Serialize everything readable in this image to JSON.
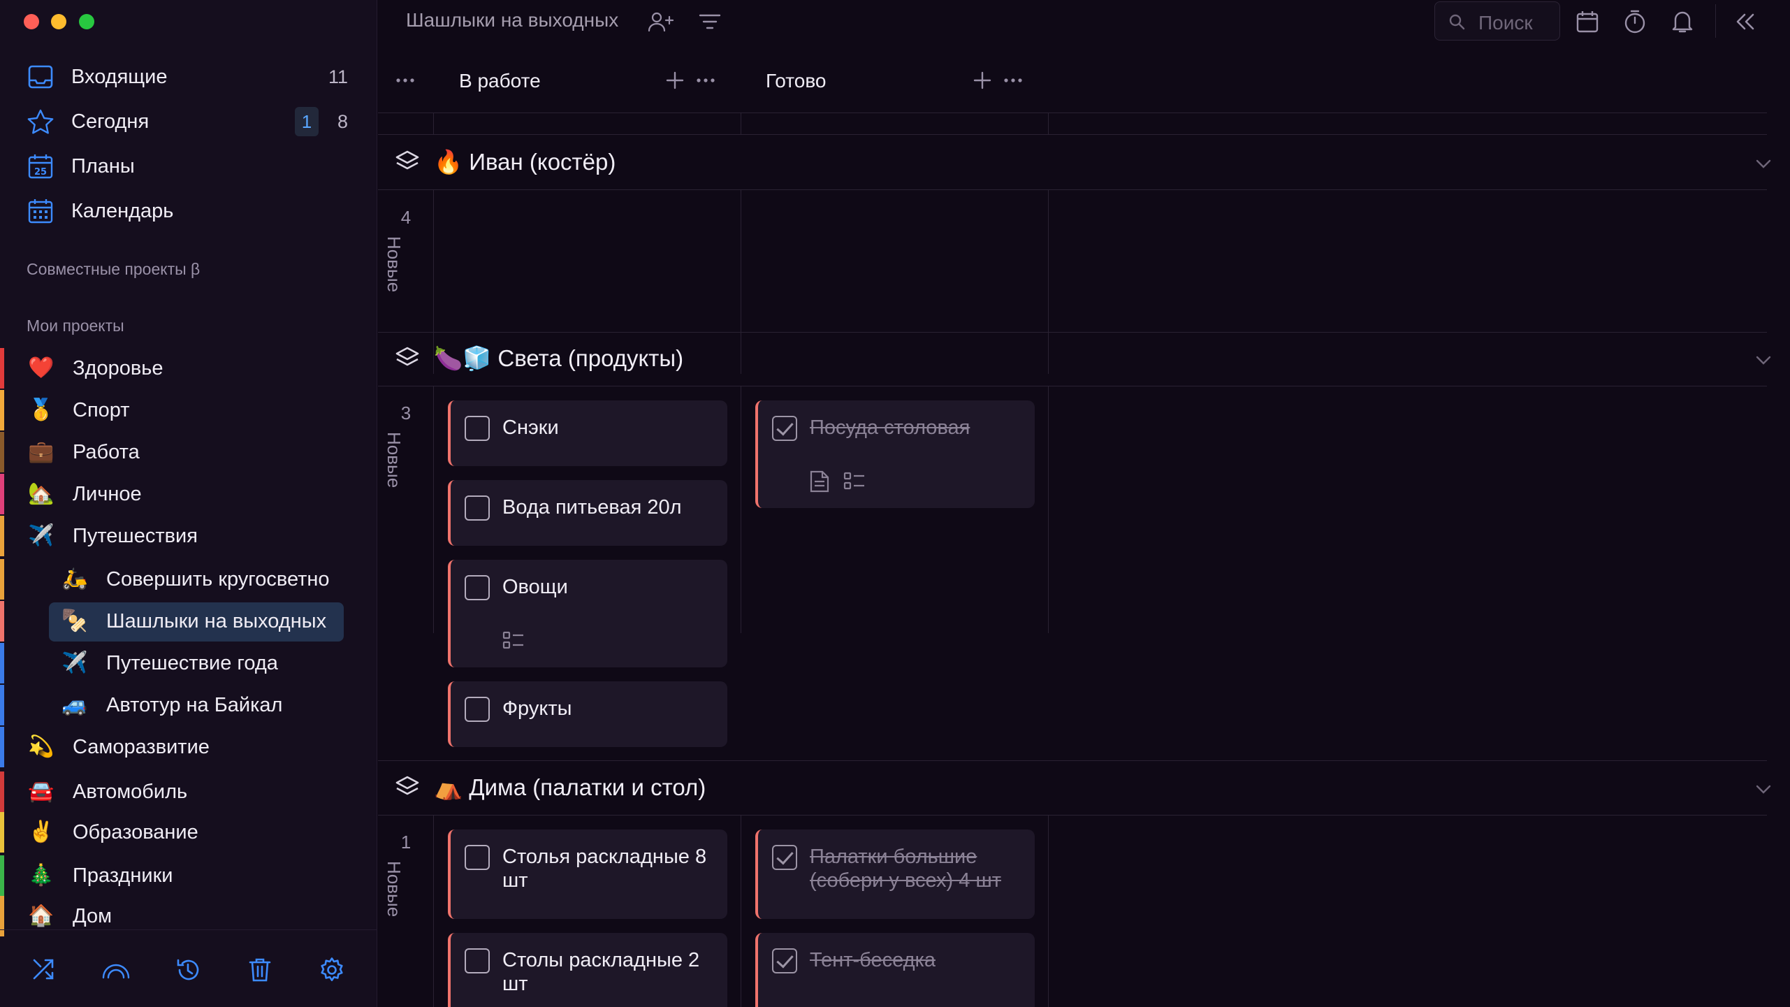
{
  "window": {
    "title": "Шашлыки на выходных"
  },
  "sidebar": {
    "nav": [
      {
        "label": "Входящие",
        "count": "11",
        "icon": "inbox-icon"
      },
      {
        "label": "Сегодня",
        "badge": "1",
        "count": "8",
        "icon": "star-icon"
      },
      {
        "label": "Планы",
        "icon": "plans-calendar-icon"
      },
      {
        "label": "Календарь",
        "icon": "calendar-grid-icon"
      }
    ],
    "shared_title": "Совместные проекты β",
    "my_title": "Мои проекты",
    "projects": [
      {
        "label": "Здоровье",
        "emoji": "❤️",
        "color": "#e23b3b"
      },
      {
        "label": "Спорт",
        "emoji": "🥇",
        "color": "#f2a93b"
      },
      {
        "label": "Работа",
        "emoji": "💼",
        "color": "#8a5a2b"
      },
      {
        "label": "Личное",
        "emoji": "🏡",
        "color": "#e0407a"
      },
      {
        "label": "Путешествия",
        "emoji": "✈️",
        "color": "#e9a23b"
      },
      {
        "label": "Совершить кругосветное путешествие",
        "emoji": "🛵",
        "sub": true
      },
      {
        "label": "Шашлыки на выходных",
        "emoji": "🍢",
        "sub": true,
        "active": true
      },
      {
        "label": "Путешествие года",
        "emoji": "✈️",
        "sub": true
      },
      {
        "label": "Автотур на Байкал",
        "emoji": "🚙",
        "sub": true
      },
      {
        "label": "Саморазвитие",
        "emoji": "💫",
        "color": "#3b7be9"
      },
      {
        "label": "Автомобиль",
        "emoji": "🚘",
        "color": "#d23b3b"
      },
      {
        "label": "Образование",
        "emoji": "✌️",
        "color": "#e9c23b"
      },
      {
        "label": "Праздники",
        "emoji": "🎄",
        "color": "#3bb54a"
      },
      {
        "label": "Дом",
        "emoji": "🏠",
        "color": "#e9a23b"
      }
    ],
    "footer_icons": [
      "shuffle-icon",
      "rainbow-icon",
      "history-icon",
      "trash-icon",
      "settings-icon"
    ]
  },
  "topbar": {
    "project_title": "Шашлыки на выходных",
    "search_placeholder": "Поиск"
  },
  "board": {
    "columns": [
      "В работе",
      "Готово"
    ],
    "groups": [
      {
        "title": "Иван (костёр)",
        "emoji": "🔥",
        "new_count": "4",
        "new_label": "Новые",
        "in_progress": [],
        "done": []
      },
      {
        "title": "Света (продукты)",
        "emoji": "🍆🧊",
        "new_count": "3",
        "new_label": "Новые",
        "in_progress": [
          {
            "text": "Снэки"
          },
          {
            "text": "Вода питьевая 20л"
          },
          {
            "text": "Овощи",
            "checklist": true
          },
          {
            "text": "Фрукты"
          }
        ],
        "done": [
          {
            "text": "Посуда столовая",
            "note": true,
            "checklist": true
          }
        ]
      },
      {
        "title": "Дима (палатки и стол)",
        "emoji": "⛺",
        "new_count": "1",
        "new_label": "Новые",
        "in_progress": [
          {
            "text": "Столья раскладные 8 шт"
          },
          {
            "text": "Столы раскладные 2 шт"
          }
        ],
        "done": [
          {
            "text": "Палатки большие (собери у всех) 4 шт"
          },
          {
            "text": "Тент-беседка"
          }
        ]
      }
    ]
  }
}
